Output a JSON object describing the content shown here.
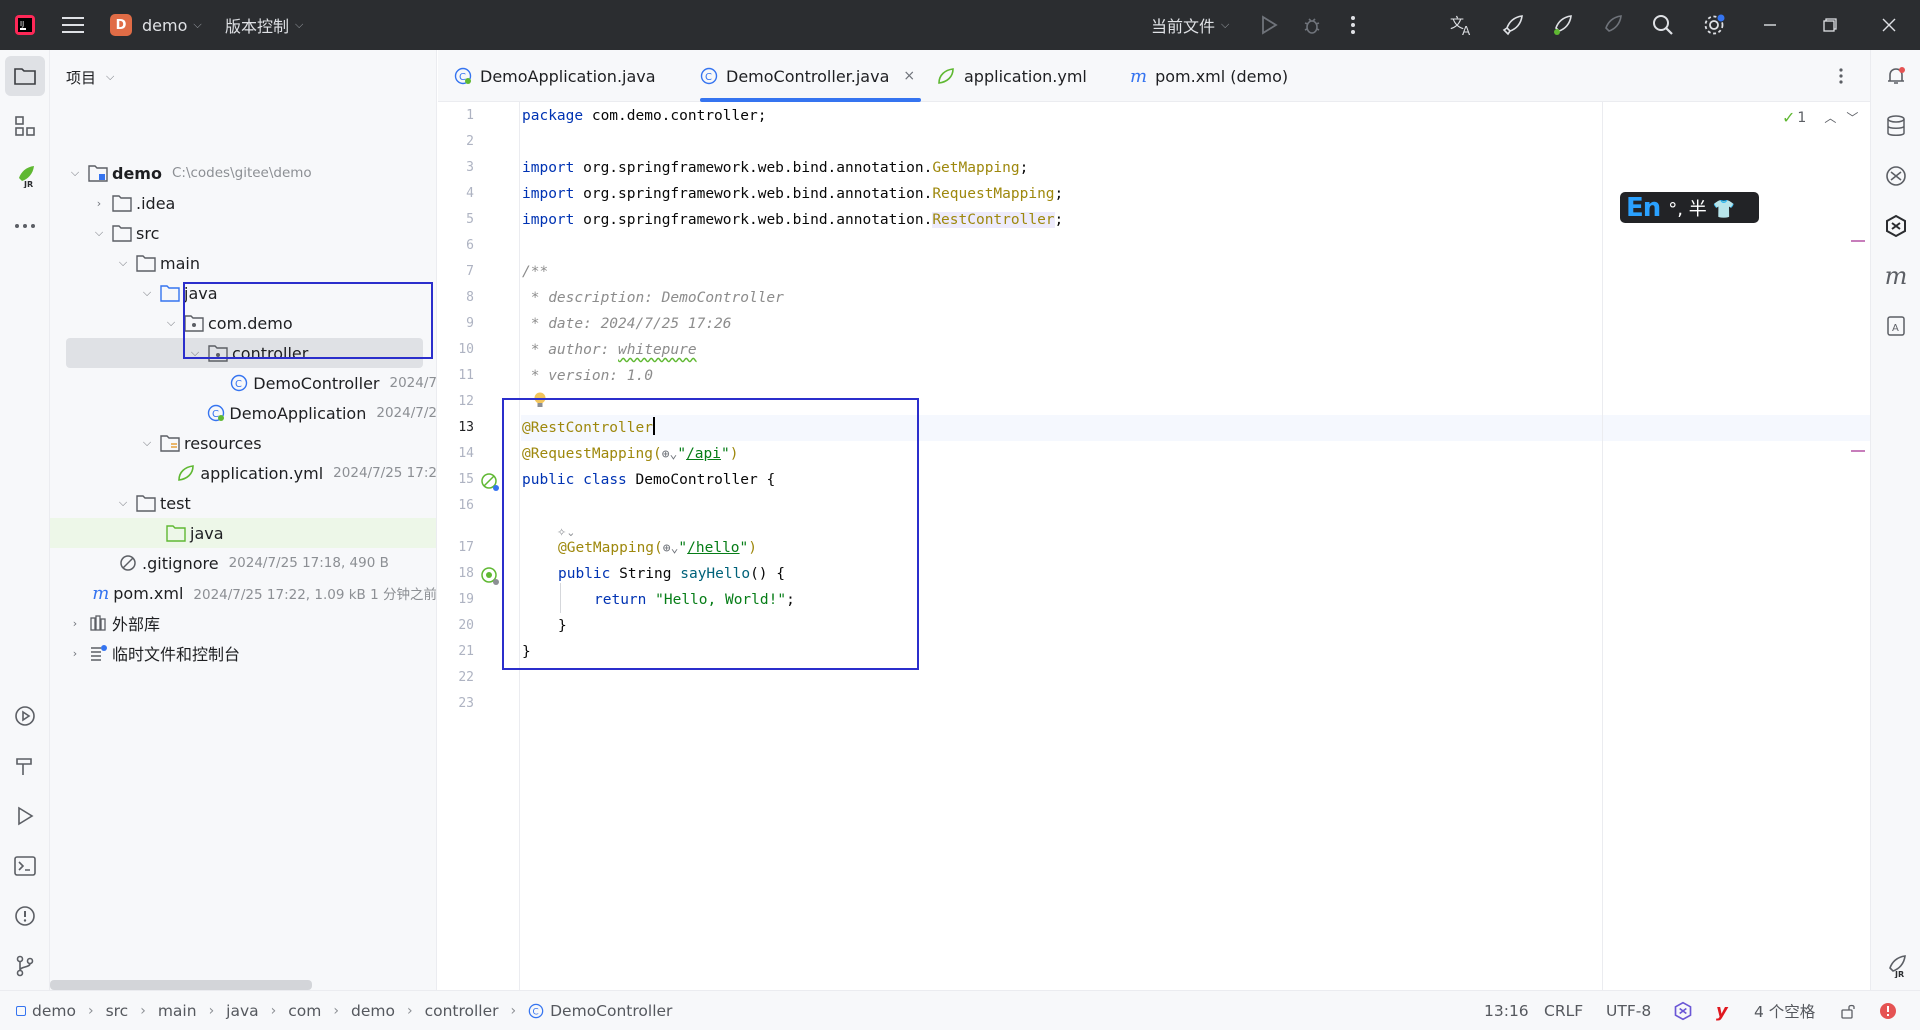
{
  "titlebar": {
    "project_badge": "D",
    "project_name": "demo",
    "vcs_label": "版本控制",
    "run_config": "当前文件"
  },
  "project_panel": {
    "title": "项目",
    "tree": [
      {
        "label": "demo",
        "meta": "C:\\codes\\gitee\\demo"
      },
      {
        "label": ".idea"
      },
      {
        "label": "src"
      },
      {
        "label": "main"
      },
      {
        "label": "java"
      },
      {
        "label": "com.demo"
      },
      {
        "label": "controller"
      },
      {
        "label": "DemoController",
        "meta": "2024/7"
      },
      {
        "label": "DemoApplication",
        "meta": "2024/7/2"
      },
      {
        "label": "resources"
      },
      {
        "label": "application.yml",
        "meta": "2024/7/25 17:2"
      },
      {
        "label": "test"
      },
      {
        "label": "java"
      },
      {
        "label": ".gitignore",
        "meta": "2024/7/25 17:18, 490 B"
      },
      {
        "label": "pom.xml",
        "meta": "2024/7/25 17:22, 1.09 kB 1 分钟之前"
      },
      {
        "label": "外部库"
      },
      {
        "label": "临时文件和控制台"
      }
    ]
  },
  "tabs": [
    {
      "label": "DemoApplication.java"
    },
    {
      "label": "DemoController.java",
      "close": "×"
    },
    {
      "label": "application.yml"
    },
    {
      "label": "pom.xml (demo)"
    }
  ],
  "editor": {
    "line_numbers": [
      "1",
      "2",
      "3",
      "4",
      "5",
      "6",
      "7",
      "8",
      "9",
      "10",
      "11",
      "12",
      "13",
      "14",
      "15",
      "16",
      "17",
      "18",
      "19",
      "20",
      "21",
      "22",
      "23"
    ],
    "code": {
      "l1_kw": "package",
      "l1_rest": " com.demo.controller;",
      "import_kw": "import",
      "l3_pkg": " org.springframework.web.bind.annotation.",
      "l3_cls": "GetMapping",
      "semi": ";",
      "l4_cls": "RequestMapping",
      "l5_cls": "RestController",
      "l7": "/**",
      "l8": " * description: DemoController",
      "l9": " * date: 2024/7/25 17:26",
      "l10_a": " * author: ",
      "l10_b": "whitepure",
      "l11": " * version: 1.0",
      "l13": "@RestController",
      "l14_a": "@RequestMapping(",
      "l14_q1": "\"",
      "l14_path": "/api",
      "l14_q2": "\"",
      "l14_end": ")",
      "l15_a": "public",
      "l15_b": "class",
      "l15_c": " DemoController {",
      "l17_a": "@GetMapping(",
      "l17_path": "/hello",
      "l17_end": ")",
      "l18_a": "public",
      "l18_b": " String ",
      "l18_fn": "sayHello",
      "l18_c": "() {",
      "l19_kw": "return",
      "l19_str": "\"Hello, World!\"",
      "l20": "}",
      "l21": "}"
    },
    "inspection_count": "1"
  },
  "ime": {
    "en": "En",
    "rest": "°, 半 👕"
  },
  "statusbar": {
    "breadcrumbs": [
      "demo",
      "src",
      "main",
      "java",
      "com",
      "demo",
      "controller",
      "DemoController"
    ],
    "position": "13:16",
    "line_separator": "CRLF",
    "encoding": "UTF-8",
    "indent": "4 个空格"
  },
  "colors": {
    "accent": "#3574f0",
    "annotation_box": "#2b2ecc",
    "title_bg": "#2b2d30"
  }
}
